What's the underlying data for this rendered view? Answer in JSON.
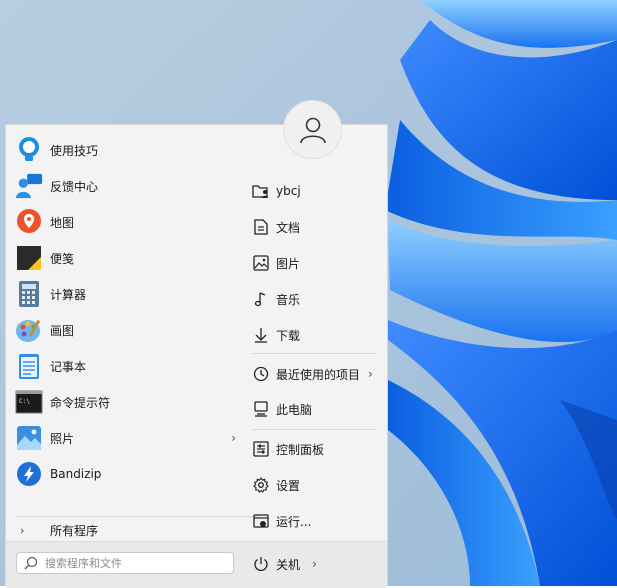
{
  "apps": [
    {
      "label": "使用技巧",
      "icon": "tips-bulb-icon"
    },
    {
      "label": "反馈中心",
      "icon": "feedback-hub-icon"
    },
    {
      "label": "地图",
      "icon": "maps-pin-icon"
    },
    {
      "label": "便笺",
      "icon": "sticky-notes-icon"
    },
    {
      "label": "计算器",
      "icon": "calculator-icon"
    },
    {
      "label": "画图",
      "icon": "paint-palette-icon"
    },
    {
      "label": "记事本",
      "icon": "notepad-icon"
    },
    {
      "label": "命令提示符",
      "icon": "command-prompt-icon",
      "icon_text": "C:\\"
    },
    {
      "label": "照片",
      "icon": "photos-icon",
      "chevron": "›"
    },
    {
      "label": "Bandizip",
      "icon": "bandizip-icon"
    }
  ],
  "all_apps": {
    "label": "所有程序",
    "chevron": "›"
  },
  "places": [
    {
      "label": "ybcj",
      "icon": "user-folder-icon"
    },
    {
      "label": "文档",
      "icon": "document-icon"
    },
    {
      "label": "图片",
      "icon": "picture-icon"
    },
    {
      "label": "音乐",
      "icon": "music-note-icon"
    },
    {
      "label": "下载",
      "icon": "download-arrow-icon"
    },
    {
      "label": "最近使用的项目",
      "icon": "clock-icon",
      "chevron": "›"
    },
    {
      "label": "此电脑",
      "icon": "computer-icon"
    },
    {
      "label": "控制面板",
      "icon": "control-panel-icon"
    },
    {
      "label": "设置",
      "icon": "gear-icon"
    },
    {
      "label": "运行...",
      "icon": "run-icon"
    }
  ],
  "search": {
    "placeholder": "搜索程序和文件"
  },
  "power": {
    "label": "关机",
    "chevron": "›"
  },
  "colors": {
    "menu_bg": "#f3f3f3",
    "bottom_bar": "#e9e9e9",
    "wallpaper_light": "#a9c3da",
    "wallpaper_blue": "#0a6cf0"
  }
}
